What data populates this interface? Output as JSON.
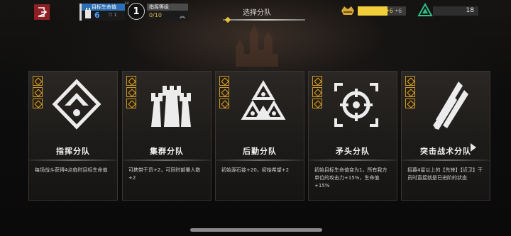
{
  "header": {
    "target_hp_label": "目标生命值",
    "target_hp_value": "6",
    "target_sub_value": "1",
    "level_badge_prefix": "LV",
    "level_value": "1",
    "level_label": "指挥等级",
    "level_progress": "0/10",
    "page_title": "选择分队",
    "gold_text_a": "6",
    "gold_text_b": "6",
    "gold_fill_fraction": 0.62,
    "green_value": "18"
  },
  "cards": [
    {
      "title": "指挥分队",
      "desc": "每场战斗获得4点临时目标生命值",
      "emblem": "diamond-eye-icon"
    },
    {
      "title": "集群分队",
      "desc": "可携带干员+2，可同时部署人数+2",
      "emblem": "castle-towers-icon"
    },
    {
      "title": "后勤分队",
      "desc": "初始源石锭+20，初始希望+2",
      "emblem": "triangles-icon"
    },
    {
      "title": "矛头分队",
      "desc": "初始目标生命值变为1，所有我方单位的攻击力+15%，生命值+15%",
      "emblem": "crosshair-icon"
    },
    {
      "title": "突击战术分队",
      "desc": "招募4星以上的【先锋】【近卫】干员时直接就是已进阶的状态",
      "emblem": "blades-icon"
    }
  ],
  "colors": {
    "back_button": "#8e1f25",
    "target_blue": "#2c6fb3",
    "gold": "#f1cf3a",
    "green": "#2fbf8a",
    "badge_gold": "#c99a2a"
  }
}
